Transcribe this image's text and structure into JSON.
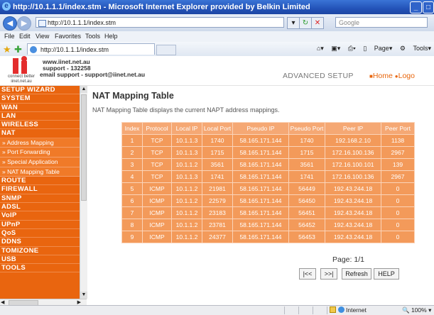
{
  "browser": {
    "title": "http://10.1.1.1/index.stm - Microsoft Internet Explorer provided by Belkin Limited",
    "url": "http://10.1.1.1/index.stm",
    "search_placeholder": "Google",
    "menu": [
      "File",
      "Edit",
      "View",
      "Favorites",
      "Tools",
      "Help"
    ],
    "tab_title": "http://10.1.1.1/index.stm",
    "command_items": [
      "Page",
      "Tools"
    ]
  },
  "header": {
    "logo_tagline": "connect better",
    "logo_domain": "iinet.net.au",
    "contact_lines": [
      "www.iinet.net.au",
      "support - 132258",
      "email support - support@iinet.net.au"
    ],
    "section_title": "ADVANCED SETUP",
    "home_link": "Home",
    "logout_link": "Logo"
  },
  "sidebar": {
    "items": [
      {
        "label": "SETUP WIZARD",
        "type": "cat"
      },
      {
        "label": "SYSTEM",
        "type": "cat"
      },
      {
        "label": "WAN",
        "type": "cat"
      },
      {
        "label": "LAN",
        "type": "cat"
      },
      {
        "label": "WIRELESS",
        "type": "cat"
      },
      {
        "label": "NAT",
        "type": "cat"
      },
      {
        "label": "» Address Mapping",
        "type": "sub"
      },
      {
        "label": "» Port Forwarding",
        "type": "sub"
      },
      {
        "label": "» Special Application",
        "type": "sub"
      },
      {
        "label": "» NAT Mapping Table",
        "type": "sub"
      },
      {
        "label": "ROUTE",
        "type": "cat"
      },
      {
        "label": "FIREWALL",
        "type": "cat"
      },
      {
        "label": "SNMP",
        "type": "cat"
      },
      {
        "label": "ADSL",
        "type": "cat"
      },
      {
        "label": "VoIP",
        "type": "cat"
      },
      {
        "label": "UPnP",
        "type": "cat"
      },
      {
        "label": "QoS",
        "type": "cat"
      },
      {
        "label": "DDNS",
        "type": "cat"
      },
      {
        "label": "TOMIZONE",
        "type": "cat"
      },
      {
        "label": "USB",
        "type": "cat"
      },
      {
        "label": "TOOLS",
        "type": "cat"
      }
    ]
  },
  "main": {
    "title": "NAT Mapping Table",
    "description": "NAT Mapping Table displays the current NAPT address mappings.",
    "columns": [
      "Index",
      "Protocol",
      "Local IP",
      "Local Port",
      "Pseudo IP",
      "Pseudo Port",
      "Peer IP",
      "Peer Port"
    ],
    "rows": [
      [
        "1",
        "TCP",
        "10.1.1.3",
        "1740",
        "58.165.171.144",
        "1740",
        "192.168.2.10",
        "1138"
      ],
      [
        "2",
        "TCP",
        "10.1.1.3",
        "1715",
        "58.165.171.144",
        "1715",
        "172.16.100.136",
        "2967"
      ],
      [
        "3",
        "TCP",
        "10.1.1.2",
        "3561",
        "58.165.171.144",
        "3561",
        "172.16.100.101",
        "139"
      ],
      [
        "4",
        "TCP",
        "10.1.1.3",
        "1741",
        "58.165.171.144",
        "1741",
        "172.16.100.136",
        "2967"
      ],
      [
        "5",
        "ICMP",
        "10.1.1.2",
        "21981",
        "58.165.171.144",
        "56449",
        "192.43.244.18",
        "0"
      ],
      [
        "6",
        "ICMP",
        "10.1.1.2",
        "22579",
        "58.165.171.144",
        "56450",
        "192.43.244.18",
        "0"
      ],
      [
        "7",
        "ICMP",
        "10.1.1.2",
        "23183",
        "58.165.171.144",
        "56451",
        "192.43.244.18",
        "0"
      ],
      [
        "8",
        "ICMP",
        "10.1.1.2",
        "23781",
        "58.165.171.144",
        "56452",
        "192.43.244.18",
        "0"
      ],
      [
        "9",
        "ICMP",
        "10.1.1.2",
        "24377",
        "58.165.171.144",
        "56453",
        "192.43.244.18",
        "0"
      ]
    ],
    "page_info": "Page: 1/1",
    "buttons": {
      "first": "|<<",
      "last": ">>|",
      "refresh": "Refresh",
      "help": "HELP"
    }
  },
  "status": {
    "zone": "Internet",
    "zoom": "100%"
  },
  "colors": {
    "accent_orange": "#e9650f",
    "table_cell": "#f39a5a",
    "table_header": "#f5a874",
    "ie_blue": "#2353b8"
  }
}
